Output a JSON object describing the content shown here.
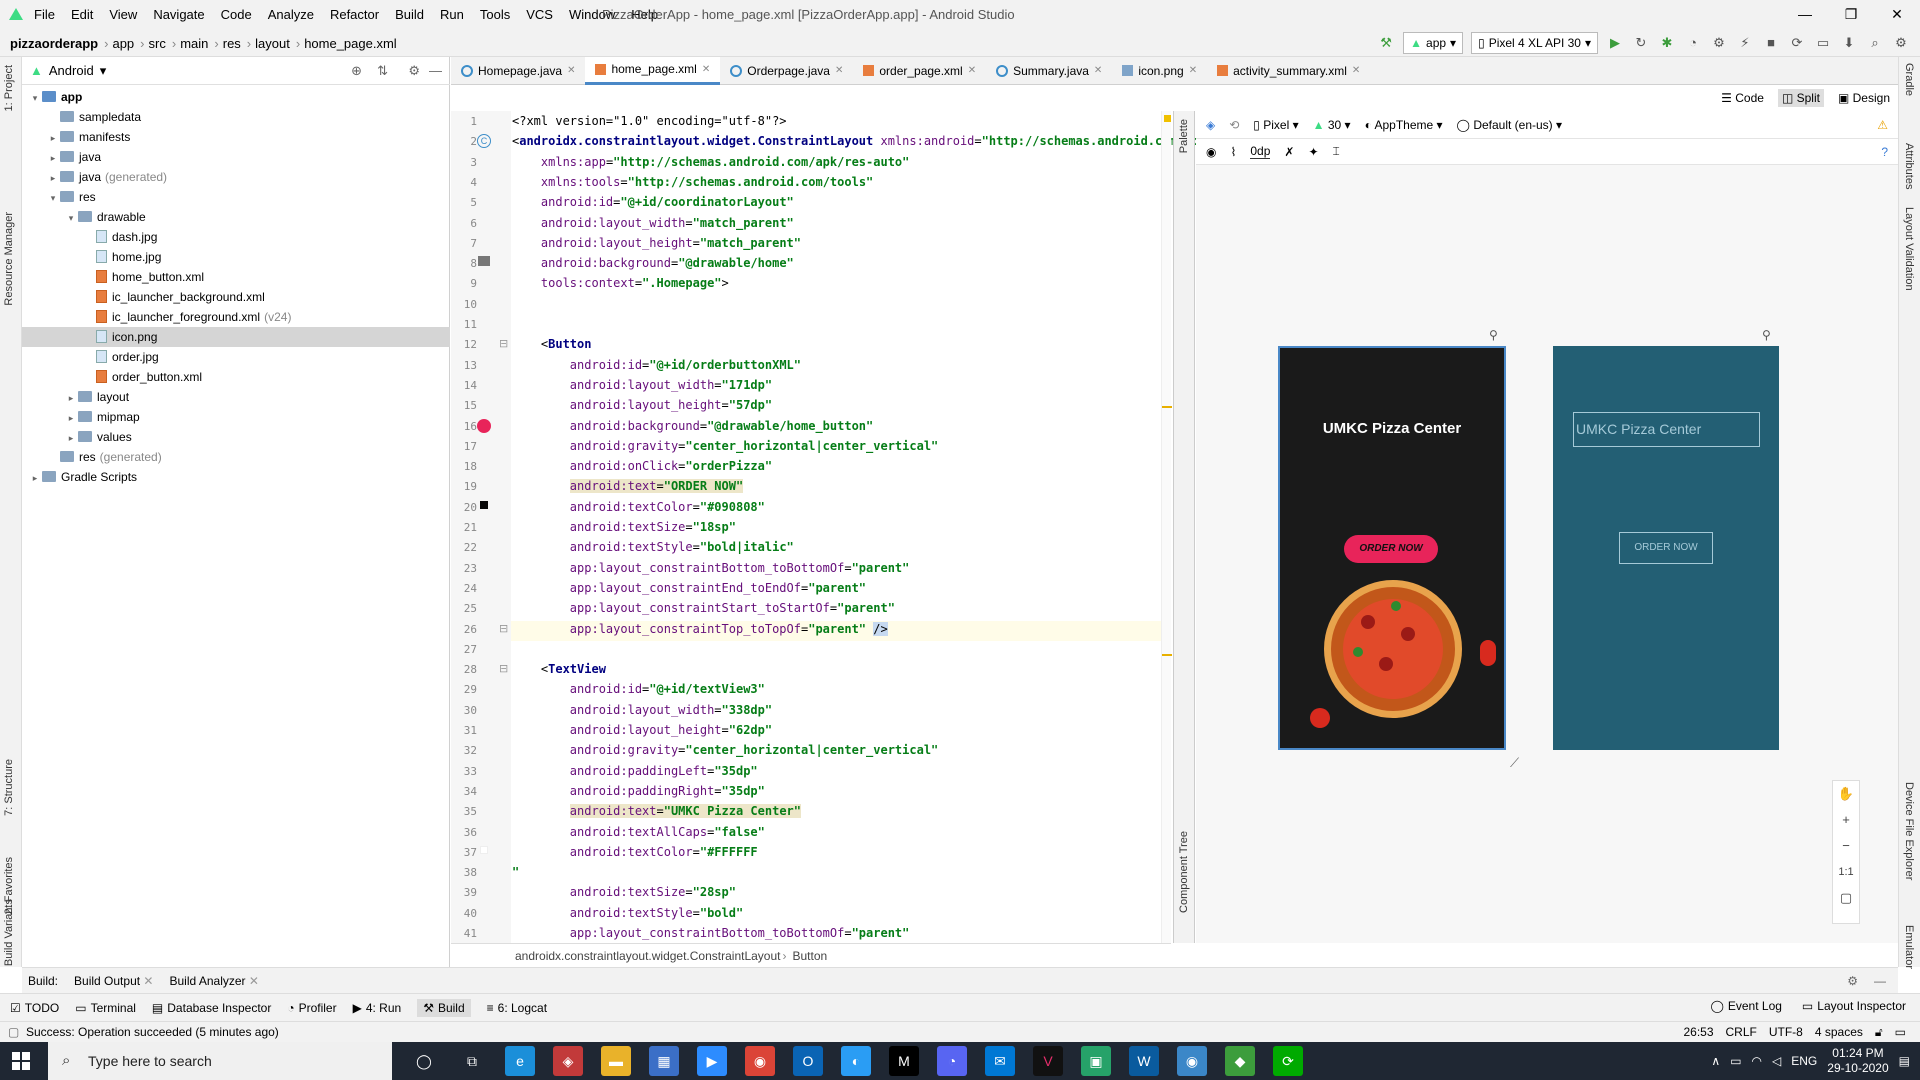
{
  "window": {
    "title": "PizzaOrderApp - home_page.xml [PizzaOrderApp.app] - Android Studio",
    "controls": [
      "—",
      "❐",
      "✕"
    ]
  },
  "menu": [
    "File",
    "Edit",
    "View",
    "Navigate",
    "Code",
    "Analyze",
    "Refactor",
    "Build",
    "Run",
    "Tools",
    "VCS",
    "Window",
    "Help"
  ],
  "breadcrumbs": [
    "pizzaorderapp",
    "app",
    "src",
    "main",
    "res",
    "layout",
    "home_page.xml"
  ],
  "runbar": {
    "config": "app",
    "device": "Pixel 4 XL API 30"
  },
  "left_strip": [
    "1: Project",
    "Resource Manager",
    "7: Structure",
    "2: Favorites",
    "Build Variants"
  ],
  "right_strip": [
    "Gradle",
    "Attributes",
    "Layout Validation",
    "Device File Explorer",
    "Emulator"
  ],
  "project": {
    "view": "Android",
    "tree": [
      {
        "label": "app",
        "extra": "",
        "level": 0,
        "kind": "folder-blue",
        "arrow": "▾",
        "bold": true
      },
      {
        "label": "sampledata",
        "extra": "",
        "level": 1,
        "kind": "folder",
        "arrow": ""
      },
      {
        "label": "manifests",
        "extra": "",
        "level": 1,
        "kind": "folder",
        "arrow": "▸"
      },
      {
        "label": "java",
        "extra": "",
        "level": 1,
        "kind": "folder",
        "arrow": "▸"
      },
      {
        "label": "java",
        "extra": "(generated)",
        "level": 1,
        "kind": "folder",
        "arrow": "▸"
      },
      {
        "label": "res",
        "extra": "",
        "level": 1,
        "kind": "folder",
        "arrow": "▾"
      },
      {
        "label": "drawable",
        "extra": "",
        "level": 2,
        "kind": "folder",
        "arrow": "▾"
      },
      {
        "label": "dash.jpg",
        "extra": "",
        "level": 3,
        "kind": "img",
        "arrow": ""
      },
      {
        "label": "home.jpg",
        "extra": "",
        "level": 3,
        "kind": "img",
        "arrow": ""
      },
      {
        "label": "home_button.xml",
        "extra": "",
        "level": 3,
        "kind": "xml",
        "arrow": ""
      },
      {
        "label": "ic_launcher_background.xml",
        "extra": "",
        "level": 3,
        "kind": "xml",
        "arrow": ""
      },
      {
        "label": "ic_launcher_foreground.xml",
        "extra": "(v24)",
        "level": 3,
        "kind": "xml",
        "arrow": ""
      },
      {
        "label": "icon.png",
        "extra": "",
        "level": 3,
        "kind": "img",
        "arrow": "",
        "selected": true
      },
      {
        "label": "order.jpg",
        "extra": "",
        "level": 3,
        "kind": "img",
        "arrow": ""
      },
      {
        "label": "order_button.xml",
        "extra": "",
        "level": 3,
        "kind": "xml",
        "arrow": ""
      },
      {
        "label": "layout",
        "extra": "",
        "level": 2,
        "kind": "folder",
        "arrow": "▸"
      },
      {
        "label": "mipmap",
        "extra": "",
        "level": 2,
        "kind": "folder",
        "arrow": "▸"
      },
      {
        "label": "values",
        "extra": "",
        "level": 2,
        "kind": "folder",
        "arrow": "▸"
      },
      {
        "label": "res",
        "extra": "(generated)",
        "level": 1,
        "kind": "folder",
        "arrow": ""
      },
      {
        "label": "Gradle Scripts",
        "extra": "",
        "level": 0,
        "kind": "folder",
        "arrow": "▸"
      }
    ]
  },
  "tabs": [
    {
      "label": "Homepage.java",
      "icon": "class",
      "active": false
    },
    {
      "label": "home_page.xml",
      "icon": "xml",
      "active": true
    },
    {
      "label": "Orderpage.java",
      "icon": "class",
      "active": false
    },
    {
      "label": "order_page.xml",
      "icon": "xml",
      "active": false
    },
    {
      "label": "Summary.java",
      "icon": "class",
      "active": false
    },
    {
      "label": "icon.png",
      "icon": "png",
      "active": false
    },
    {
      "label": "activity_summary.xml",
      "icon": "xml",
      "active": false
    }
  ],
  "editor_modes": {
    "code": "Code",
    "split": "Split",
    "design": "Design"
  },
  "code": [
    {
      "n": 1,
      "html": "&lt;?xml version=\"1.0\" encoding=\"utf-8\"?&gt;"
    },
    {
      "n": 2,
      "html": "&lt;<span class='t'>androidx.constraintlayout.widget.ConstraintLayout</span> <span class='a'>xmlns:android</span>=<span class='s'>\"http://schemas.android.com/ap</span>"
    },
    {
      "n": 3,
      "html": "    <span class='a'>xmlns:app</span>=<span class='s'>\"http://schemas.android.com/apk/res-auto\"</span>"
    },
    {
      "n": 4,
      "html": "    <span class='a'>xmlns:tools</span>=<span class='s'>\"http://schemas.android.com/tools\"</span>"
    },
    {
      "n": 5,
      "html": "    <span class='a'>android:id</span>=<span class='s'>\"@+id/coordinatorLayout\"</span>"
    },
    {
      "n": 6,
      "html": "    <span class='a'>android:layout_width</span>=<span class='s'>\"match_parent\"</span>"
    },
    {
      "n": 7,
      "html": "    <span class='a'>android:layout_height</span>=<span class='s'>\"match_parent\"</span>"
    },
    {
      "n": 8,
      "html": "    <span class='a'>android:background</span>=<span class='s'>\"@drawable/home\"</span>"
    },
    {
      "n": 9,
      "html": "    <span class='a'>tools:context</span>=<span class='s'>\".Homepage\"</span>&gt;"
    },
    {
      "n": 10,
      "html": ""
    },
    {
      "n": 11,
      "html": ""
    },
    {
      "n": 12,
      "html": "    &lt;<span class='t'>Button</span>"
    },
    {
      "n": 13,
      "html": "        <span class='a'>android:id</span>=<span class='s'>\"@+id/orderbuttonXML\"</span>"
    },
    {
      "n": 14,
      "html": "        <span class='a'>android:layout_width</span>=<span class='s'>\"171dp\"</span>"
    },
    {
      "n": 15,
      "html": "        <span class='a'>android:layout_height</span>=<span class='s'>\"57dp\"</span>"
    },
    {
      "n": 16,
      "html": "        <span class='a'>android:background</span>=<span class='s'>\"@drawable/home_button\"</span>"
    },
    {
      "n": 17,
      "html": "        <span class='a'>android:gravity</span>=<span class='s'>\"center_horizontal|center_vertical\"</span>"
    },
    {
      "n": 18,
      "html": "        <span class='a'>android:onClick</span>=<span class='s'>\"orderPizza\"</span>"
    },
    {
      "n": 19,
      "html": "        <span class='hl'><span class='a'>android:text</span>=<span class='s'>\"ORDER NOW\"</span></span>"
    },
    {
      "n": 20,
      "html": "        <span class='a'>android:textColor</span>=<span class='s'>\"#090808\"</span>"
    },
    {
      "n": 21,
      "html": "        <span class='a'>android:textSize</span>=<span class='s'>\"18sp\"</span>"
    },
    {
      "n": 22,
      "html": "        <span class='a'>android:textStyle</span>=<span class='s'>\"bold|italic\"</span>"
    },
    {
      "n": 23,
      "html": "        <span class='a'>app:layout_constraintBottom_toBottomOf</span>=<span class='s'>\"parent\"</span>"
    },
    {
      "n": 24,
      "html": "        <span class='a'>app:layout_constraintEnd_toEndOf</span>=<span class='s'>\"parent\"</span>"
    },
    {
      "n": 25,
      "html": "        <span class='a'>app:layout_constraintStart_toStartOf</span>=<span class='s'>\"parent\"</span>"
    },
    {
      "n": 26,
      "html": "        <span class='a'>app:layout_constraintTop_toTopOf</span>=<span class='s'>\"parent\"</span> <span style='background:#c6d9f0'>/&gt;</span>"
    },
    {
      "n": 27,
      "html": ""
    },
    {
      "n": 28,
      "html": "    &lt;<span class='t'>TextView</span>"
    },
    {
      "n": 29,
      "html": "        <span class='a'>android:id</span>=<span class='s'>\"@+id/textView3\"</span>"
    },
    {
      "n": 30,
      "html": "        <span class='a'>android:layout_width</span>=<span class='s'>\"338dp\"</span>"
    },
    {
      "n": 31,
      "html": "        <span class='a'>android:layout_height</span>=<span class='s'>\"62dp\"</span>"
    },
    {
      "n": 32,
      "html": "        <span class='a'>android:gravity</span>=<span class='s'>\"center_horizontal|center_vertical\"</span>"
    },
    {
      "n": 33,
      "html": "        <span class='a'>android:paddingLeft</span>=<span class='s'>\"35dp\"</span>"
    },
    {
      "n": 34,
      "html": "        <span class='a'>android:paddingRight</span>=<span class='s'>\"35dp\"</span>"
    },
    {
      "n": 35,
      "html": "        <span class='hl'><span class='a'>android:text</span>=<span class='s'>\"UMKC Pizza Center\"</span></span>"
    },
    {
      "n": 36,
      "html": "        <span class='a'>android:textAllCaps</span>=<span class='s'>\"false\"</span>"
    },
    {
      "n": 37,
      "html": "        <span class='a'>android:textColor</span>=<span class='s'>\"#FFFFFF</span>"
    },
    {
      "n": 38,
      "html": "<span class='s'>\"</span>"
    },
    {
      "n": 39,
      "html": "        <span class='a'>android:textSize</span>=<span class='s'>\"28sp\"</span>"
    },
    {
      "n": 40,
      "html": "        <span class='a'>android:textStyle</span>=<span class='s'>\"bold\"</span>"
    },
    {
      "n": 41,
      "html": "        <span class='a'>app:layout_constraintBottom_toBottomOf</span>=<span class='s'>\"parent\"</span>"
    }
  ],
  "code_breadcrumb": [
    "androidx.constraintlayout.widget.ConstraintLayout",
    "Button"
  ],
  "palette_label": "Palette",
  "component_tree_label": "Component Tree",
  "design_toolbar": {
    "device": "Pixel",
    "api": "30",
    "theme": "AppTheme",
    "locale": "Default (en-us)",
    "margin": "0dp"
  },
  "preview": {
    "title": "UMKC Pizza Center",
    "button": "ORDER NOW"
  },
  "blueprint": {
    "title": "UMKC Pizza Center",
    "button": "ORDER NOW"
  },
  "zoom": [
    "✋",
    "+",
    "−",
    "1:1",
    "▢"
  ],
  "build_bar": {
    "label": "Build:",
    "tabs": [
      "Build Output",
      "Build Analyzer"
    ]
  },
  "tool_windows": [
    "TODO",
    "Terminal",
    "Database Inspector",
    "Profiler",
    "4: Run",
    "Build",
    "6: Logcat"
  ],
  "tool_windows_right": [
    "Event Log",
    "Layout Inspector"
  ],
  "status": {
    "message": "Success: Operation succeeded (5 minutes ago)",
    "position": "26:53",
    "line_sep": "CRLF",
    "encoding": "UTF-8",
    "indent": "4 spaces"
  },
  "taskbar": {
    "search": "Type here to search",
    "lang": "ENG",
    "time": "01:24 PM",
    "date": "29-10-2020"
  },
  "colors": {
    "accent": "#4a88c7",
    "button_pink": "#e8245a",
    "blueprint": "#235f74"
  }
}
